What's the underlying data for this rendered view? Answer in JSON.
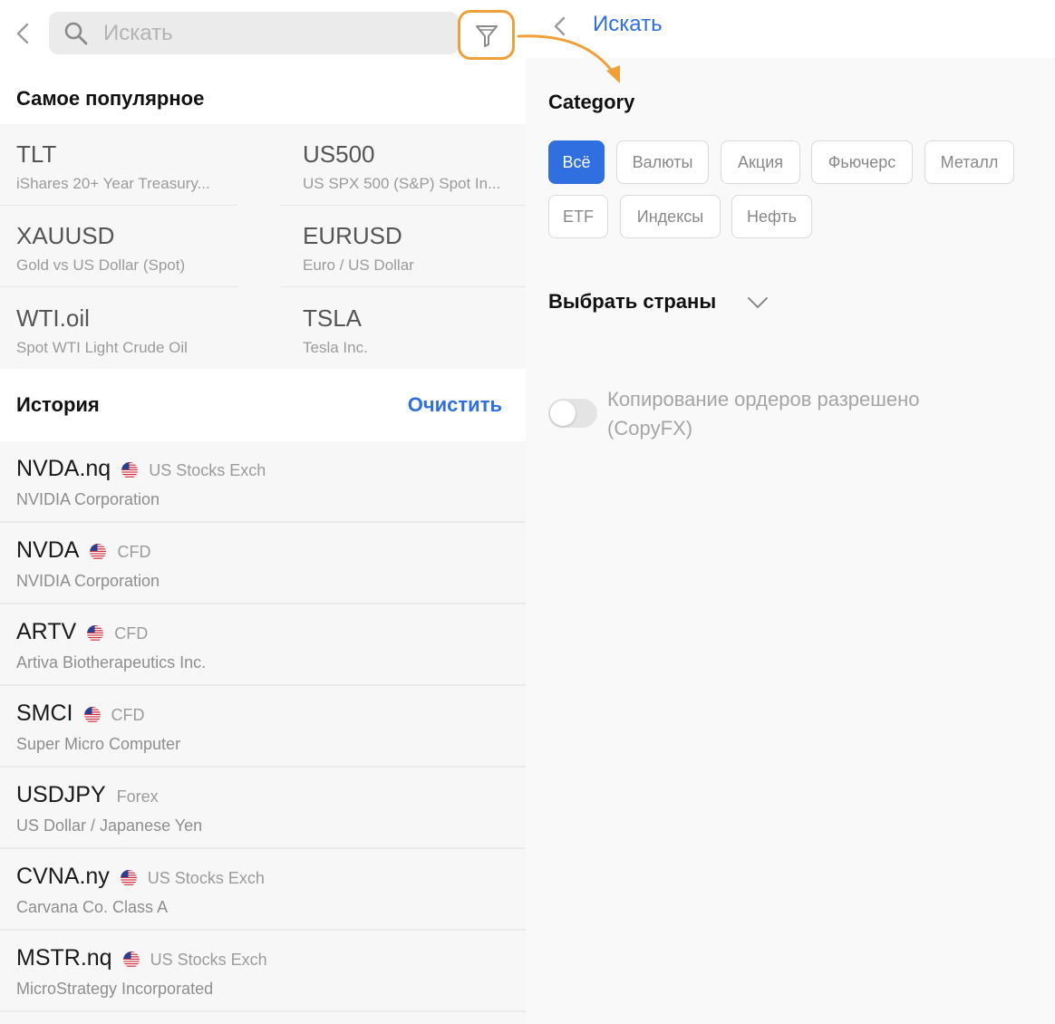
{
  "left": {
    "search": {
      "placeholder": "Искать"
    },
    "popular": {
      "title": "Самое популярное",
      "items": [
        {
          "symbol": "TLT",
          "name": "iShares 20+ Year Treasury..."
        },
        {
          "symbol": "US500",
          "name": "US SPX 500 (S&P) Spot In..."
        },
        {
          "symbol": "XAUUSD",
          "name": "Gold vs US Dollar (Spot)"
        },
        {
          "symbol": "EURUSD",
          "name": "Euro / US Dollar"
        },
        {
          "symbol": "WTI.oil",
          "name": "Spot WTI Light Crude Oil"
        },
        {
          "symbol": "TSLA",
          "name": "Tesla Inc."
        }
      ]
    },
    "history": {
      "title": "История",
      "clear_label": "Очистить",
      "items": [
        {
          "symbol": "NVDA.nq",
          "exchange": "US Stocks Exch",
          "name": "NVIDIA Corporation",
          "flag": true
        },
        {
          "symbol": "NVDA",
          "exchange": "CFD",
          "name": "NVIDIA Corporation",
          "flag": true
        },
        {
          "symbol": "ARTV",
          "exchange": "CFD",
          "name": "Artiva Biotherapeutics Inc.",
          "flag": true
        },
        {
          "symbol": "SMCI",
          "exchange": "CFD",
          "name": "Super Micro Computer",
          "flag": true
        },
        {
          "symbol": "USDJPY",
          "exchange": "Forex",
          "name": "US Dollar / Japanese Yen",
          "flag": false
        },
        {
          "symbol": "CVNA.ny",
          "exchange": "US Stocks Exch",
          "name": "Carvana Co. Class A",
          "flag": true
        },
        {
          "symbol": "MSTR.nq",
          "exchange": "US Stocks Exch",
          "name": "MicroStrategy Incorporated",
          "flag": true
        }
      ]
    }
  },
  "right": {
    "title": "Искать",
    "category": {
      "title": "Category",
      "chips": [
        "Всё",
        "Валюты",
        "Акция",
        "Фьючерс",
        "Металл",
        "ETF",
        "Индексы",
        "Нефть"
      ],
      "active": "Всё"
    },
    "countries_label": "Выбрать страны",
    "copy_toggle": {
      "label": "Копирование ордеров разрешено (CopyFX)",
      "enabled": false
    }
  },
  "colors": {
    "accent": "#2f6fe0",
    "highlight": "#f0a03a"
  },
  "icons": [
    "back-arrow-icon",
    "search-icon",
    "filter-icon",
    "us-flag-icon",
    "chevron-down-icon"
  ]
}
